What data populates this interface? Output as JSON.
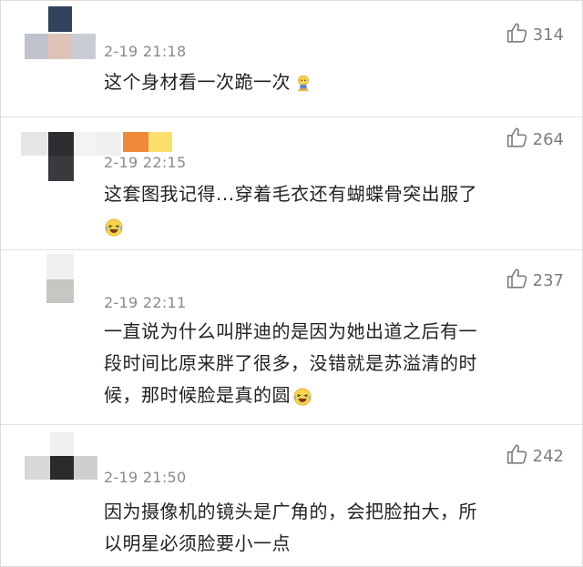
{
  "comments": [
    {
      "time": "2-19 21:18",
      "likes": "314",
      "lines": [
        "这个身材看一次跪一次"
      ],
      "emoji": "kneel-emoji-icon"
    },
    {
      "time": "2-19 22:15",
      "likes": "264",
      "lines": [
        "这套图我记得...穿着毛衣还有蝴蝶骨突出服了"
      ],
      "emoji": "laugh-cry-emoji-icon"
    },
    {
      "time": "2-19 22:11",
      "likes": "237",
      "lines": [
        "一直说为什么叫胖迪的是因为她出道之后有一",
        "段时间比原来胖了很多，没错就是苏溢清的时",
        "候，那时候脸是真的圆"
      ],
      "emoji": "laugh-cry-emoji-icon"
    },
    {
      "time": "2-19 21:50",
      "likes": "242",
      "lines": [
        "因为摄像机的镜头是广角的，会把脸拍大，所",
        "以明星必须脸要小一点"
      ],
      "emoji": ""
    }
  ],
  "icons": {
    "like": "thumbs-up-icon"
  },
  "colors": {
    "text": "#222222",
    "meta": "#8a8a8a",
    "divider": "#e2e2e2"
  }
}
